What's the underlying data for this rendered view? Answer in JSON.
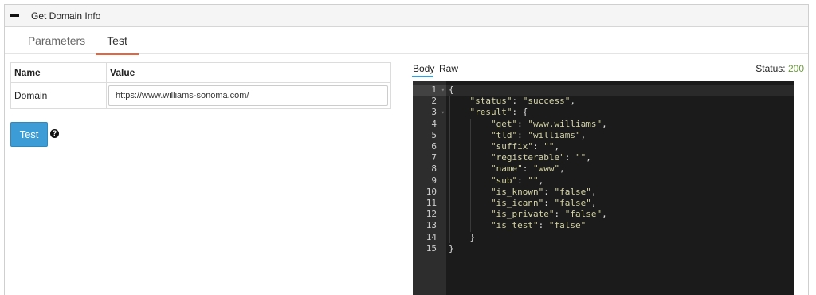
{
  "panel": {
    "title": "Get Domain Info",
    "collapse_icon": "minus-icon"
  },
  "tabs": [
    {
      "label": "Parameters"
    },
    {
      "label": "Test"
    }
  ],
  "params_table": {
    "headers": {
      "name": "Name",
      "value": "Value"
    },
    "rows": [
      {
        "name": "Domain",
        "value": "https://www.williams-sonoma.com/"
      }
    ]
  },
  "test_button": {
    "label": "Test"
  },
  "help_icon": {
    "glyph": "?"
  },
  "response": {
    "tabs": [
      {
        "label": "Body"
      },
      {
        "label": "Raw"
      }
    ],
    "status_label": "Status:",
    "status_code": "200",
    "status_color": "#6a9a3a",
    "lines": [
      "{",
      "    \"status\": \"success\",",
      "    \"result\": {",
      "        \"get\": \"www.williams\",",
      "        \"tld\": \"williams\",",
      "        \"suffix\": \"\",",
      "        \"registerable\": \"\",",
      "        \"name\": \"www\",",
      "        \"sub\": \"\",",
      "        \"is_known\": \"false\",",
      "        \"is_icann\": \"false\",",
      "        \"is_private\": \"false\",",
      "        \"is_test\": \"false\"",
      "    }",
      "}"
    ],
    "fold_lines": [
      1,
      3
    ]
  },
  "colors": {
    "accent": "#3b9cd6",
    "tab_underline": "#e8643c",
    "editor_bg": "#1b1b1b"
  }
}
